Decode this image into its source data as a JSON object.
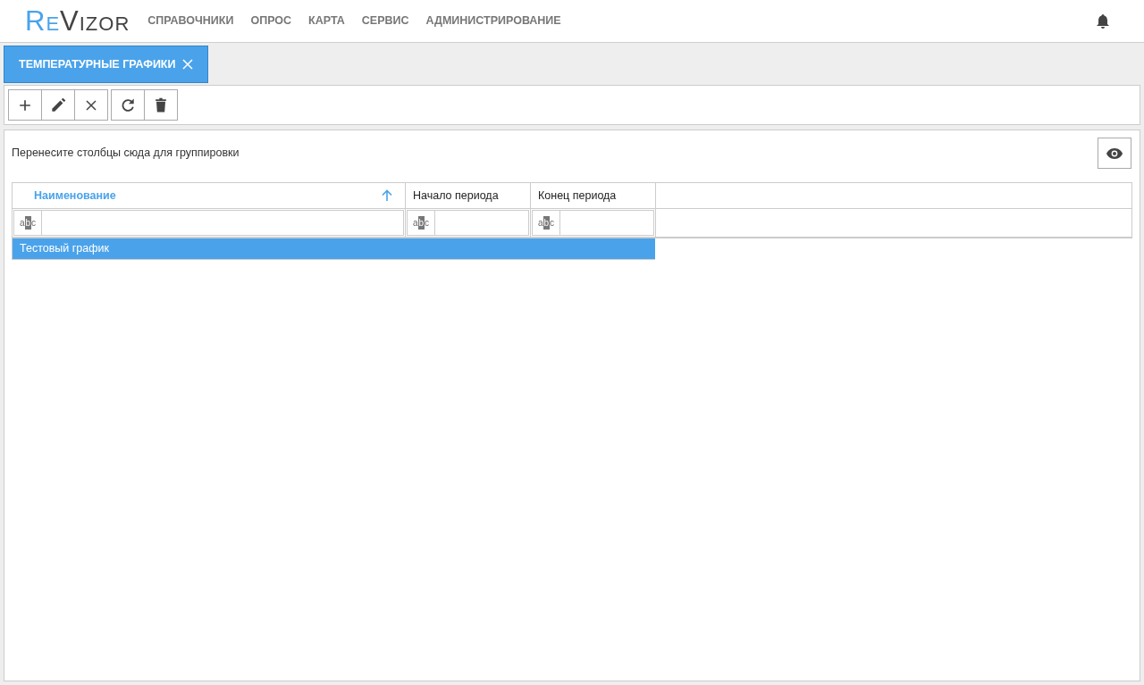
{
  "logo": {
    "accent": "Re",
    "rest": "Vizor"
  },
  "menu": [
    "СПРАВОЧНИКИ",
    "ОПРОС",
    "КАРТА",
    "СЕРВИС",
    "АДМИНИСТРИРОВАНИЕ"
  ],
  "tabs": [
    {
      "label": "ТЕМПЕРАТУРНЫЕ ГРАФИКИ",
      "selected": true
    }
  ],
  "toolbar": [
    {
      "kind": "add"
    },
    {
      "kind": "edit"
    },
    {
      "kind": "cancel"
    },
    {
      "kind": "refresh"
    },
    {
      "kind": "delete"
    }
  ],
  "group_hint": "Перенесите столбцы сюда для группировки",
  "table": {
    "columns": [
      {
        "label": "Наименование",
        "sorted": true,
        "filter": "abc"
      },
      {
        "label": "Начало периода",
        "sorted": false,
        "filter": "abc"
      },
      {
        "label": "Конец периода",
        "sorted": false,
        "filter": "abc"
      }
    ],
    "rows": [
      {
        "cells": [
          "Тестовый график",
          "",
          ""
        ],
        "selected": true
      }
    ]
  }
}
